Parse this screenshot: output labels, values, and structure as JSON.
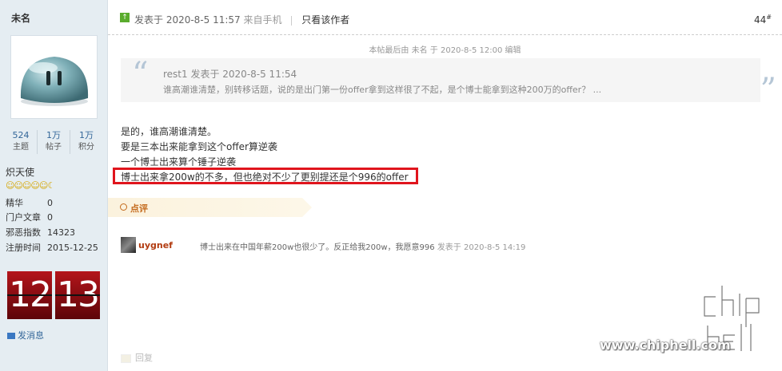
{
  "author": {
    "name": "未名",
    "stats": [
      {
        "value": "524",
        "label": "主题"
      },
      {
        "value": "1万",
        "label": "帖子"
      },
      {
        "value": "1万",
        "label": "积分"
      }
    ],
    "rank": "炽天使",
    "stars": "☺☺☺☺☺☾",
    "info": [
      {
        "key": "精华",
        "value": "0"
      },
      {
        "key": "门户文章",
        "value": "0"
      },
      {
        "key": "邪恶指数",
        "value": "14323"
      },
      {
        "key": "注册时间",
        "value": "2015-12-25"
      }
    ],
    "clock": {
      "hour": "12",
      "minute": "13"
    },
    "send_message": "发消息"
  },
  "post": {
    "posted_label": "发表于 2020-8-5 11:57",
    "source": "来自手机",
    "only_author": "只看该作者",
    "floor": "44",
    "floor_mark": "#",
    "edited_note": "本帖最后由 未名 于 2020-8-5 12:00 编辑",
    "quote": {
      "header": "rest1 发表于 2020-8-5 11:54",
      "body": "谁高潮谁清楚，别转移话题，说的是出门第一份offer拿到这样很了不起，是个博士能拿到这种200万的offer？ ..."
    },
    "lines": [
      "是的，谁高潮谁清楚。",
      "要是三本出来能拿到这个offer算逆袭",
      "一个博士出来算个锤子逆袭",
      "博士出来拿200w的不多，但也绝对不少了更别提还是个996的offer"
    ],
    "rating_label": "点评",
    "comment": {
      "user": "uygnef",
      "text": "博士出来在中国年薪200w也很少了。反正给我200w，我愿意996",
      "time": "发表于 2020-8-5 14:19"
    },
    "reply_label": "回复"
  },
  "watermark": {
    "url": "www.chiphell.com"
  },
  "colors": {
    "sidebar_bg": "#e5edf2",
    "highlight_border": "#e0151d",
    "link": "#336699",
    "comment_user": "#b23b10"
  }
}
